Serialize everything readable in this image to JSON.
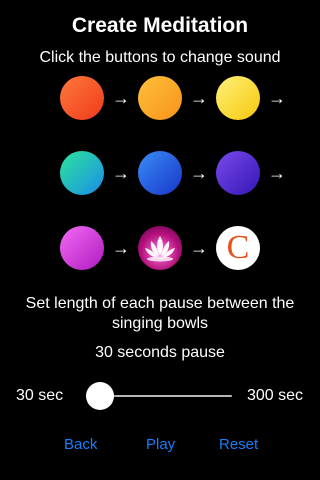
{
  "header": {
    "title": "Create Meditation",
    "subtitle": "Click the buttons to change sound"
  },
  "arrow_glyph": "→",
  "sound_rows": [
    {
      "buttons": [
        {
          "kind": "orb",
          "gradient": [
            "#ff7a3c",
            "#ee3a1a"
          ]
        },
        {
          "kind": "orb",
          "gradient": [
            "#ffbf3a",
            "#f7941a"
          ]
        },
        {
          "kind": "orb",
          "gradient": [
            "#fff07a",
            "#f6c80c"
          ]
        }
      ]
    },
    {
      "buttons": [
        {
          "kind": "orb",
          "gradient": [
            "#2ee59a",
            "#1a8ce8"
          ]
        },
        {
          "kind": "orb",
          "gradient": [
            "#3a8cf6",
            "#1836c8"
          ]
        },
        {
          "kind": "orb",
          "gradient": [
            "#7a4aec",
            "#3416b4"
          ]
        }
      ]
    },
    {
      "buttons": [
        {
          "kind": "orb",
          "gradient": [
            "#f26cf4",
            "#b01ac0"
          ]
        },
        {
          "kind": "lotus",
          "icon": "lotus-icon"
        },
        {
          "kind": "logo",
          "icon": "c-logo-icon",
          "glyph": "C"
        }
      ]
    }
  ],
  "pause": {
    "instruction": "Set length of each pause between the singing bowls",
    "current_label": "30 seconds pause",
    "min_label": "30 sec",
    "max_label": "300 sec",
    "value_fraction": 0
  },
  "actions": {
    "back": "Back",
    "play": "Play",
    "reset": "Reset"
  },
  "colors": {
    "background": "#000000",
    "accent": "#147efb",
    "slider_track": "#b6b6b6"
  }
}
